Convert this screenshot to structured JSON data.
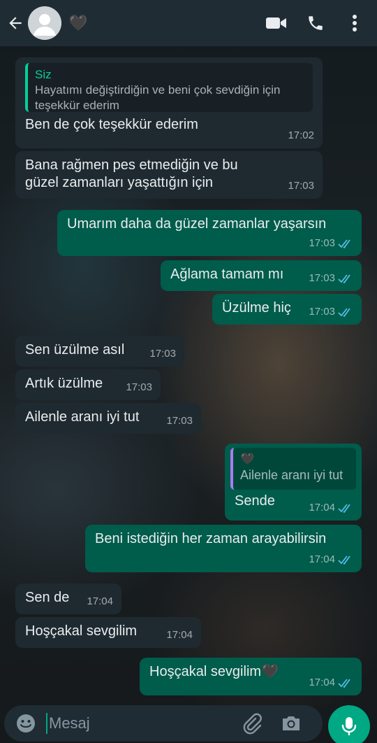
{
  "header": {
    "contact_name": "🖤",
    "icons": [
      "back-arrow-icon",
      "avatar-placeholder",
      "video-call-icon",
      "phone-icon",
      "more-vert-icon"
    ]
  },
  "messages": [
    {
      "dir": "in",
      "quote_author": "Siz",
      "quote_text": "Hayatımı değiştirdiğin ve beni çok sevdiğin için teşekkür ederim",
      "text": "Ben de çok teşekkür ederim",
      "time": "17:02"
    },
    {
      "dir": "in",
      "text": "Bana rağmen pes etmediğin ve bu güzel zamanları yaşattığın için",
      "time": "17:03"
    },
    {
      "dir": "out",
      "text": "Umarım daha da güzel zamanlar yaşarsın",
      "time": "17:03"
    },
    {
      "dir": "out",
      "text": "Ağlama tamam mı",
      "time": "17:03"
    },
    {
      "dir": "out",
      "text": "Üzülme hiç",
      "time": "17:03"
    },
    {
      "dir": "in",
      "text": "Sen üzülme asıl",
      "time": "17:03"
    },
    {
      "dir": "in",
      "text": "Artık üzülme",
      "time": "17:03"
    },
    {
      "dir": "in",
      "text": "Ailenle aranı iyi tut",
      "time": "17:03"
    },
    {
      "dir": "out",
      "quote_author": "🖤",
      "quote_text": "Ailenle aranı iyi tut",
      "text": "Sende",
      "time": "17:04"
    },
    {
      "dir": "out",
      "text": "Beni istediğin her zaman arayabilirsin",
      "time": "17:04"
    },
    {
      "dir": "in",
      "text": "Sen de",
      "time": "17:04"
    },
    {
      "dir": "in",
      "text": "Hoşçakal sevgilim",
      "time": "17:04"
    },
    {
      "dir": "out",
      "text": "Hoşçakal sevgilim🖤",
      "time": "17:04"
    }
  ],
  "composer": {
    "placeholder": "Mesaj",
    "icons": [
      "emoji-icon",
      "attach-icon",
      "camera-icon",
      "mic-icon"
    ]
  },
  "colors": {
    "header_bg": "#1f2c34",
    "incoming_bubble": "#1f2a30",
    "outgoing_bubble": "#005c4b",
    "accent": "#00a884",
    "read_ticks": "#53bdeb"
  }
}
